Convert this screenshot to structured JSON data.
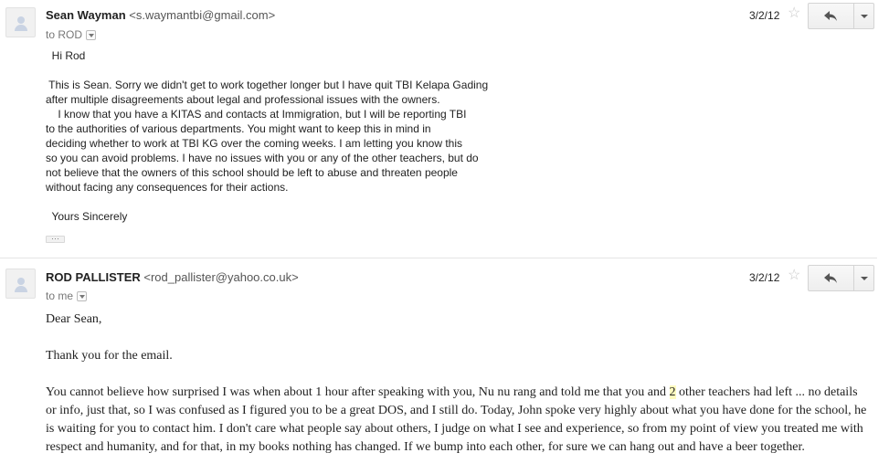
{
  "messages": [
    {
      "sender_name": "Sean Wayman",
      "sender_email": "<s.waymantbi@gmail.com>",
      "recipient": "to ROD",
      "date": "3/2/12",
      "body": "  Hi Rod\n\n This is Sean. Sorry we didn't get to work together longer but I have quit TBI Kelapa Gading\nafter multiple disagreements about legal and professional issues with the owners.\n    I know that you have a KITAS and contacts at Immigration, but I will be reporting TBI\nto the authorities of various departments. You might want to keep this in mind in\ndeciding whether to work at TBI KG over the coming weeks. I am letting you know this\nso you can avoid problems. I have no issues with you or any of the other teachers, but do\nnot believe that the owners of this school should be left to abuse and threaten people\nwithout facing any consequences for their actions.\n\n  Yours Sincerely",
      "collapsed_label": "···"
    },
    {
      "sender_name": "ROD PALLISTER",
      "sender_email": "<rod_pallister@yahoo.co.uk>",
      "recipient": "to me",
      "date": "3/2/12",
      "greeting": "Dear Sean,",
      "thanks": "Thank you for the email.",
      "para_before": "You cannot believe how surprised I was when about 1 hour after speaking with you, Nu nu rang and told me that you and ",
      "para_highlight": "2",
      "para_after": " other teachers had left ... no details or info, just that, so I was confused as I figured you to be a great DOS, and I still do. Today, John spoke very highly about what you have done for the school, he is waiting for you to contact him. I don't care what people say about others, I judge on what I see and experience, so from my point of view you treated me with respect and humanity, and for that, in my books nothing has changed. If we bump into each other, for sure we can hang out and have a beer together."
    }
  ],
  "icons": {
    "star": "☆",
    "reply": "reply-icon",
    "more": "chevron-down-icon",
    "avatar": "default-avatar-icon"
  },
  "colors": {
    "highlight": "#fffbbf",
    "divider": "#e5e5e5"
  }
}
